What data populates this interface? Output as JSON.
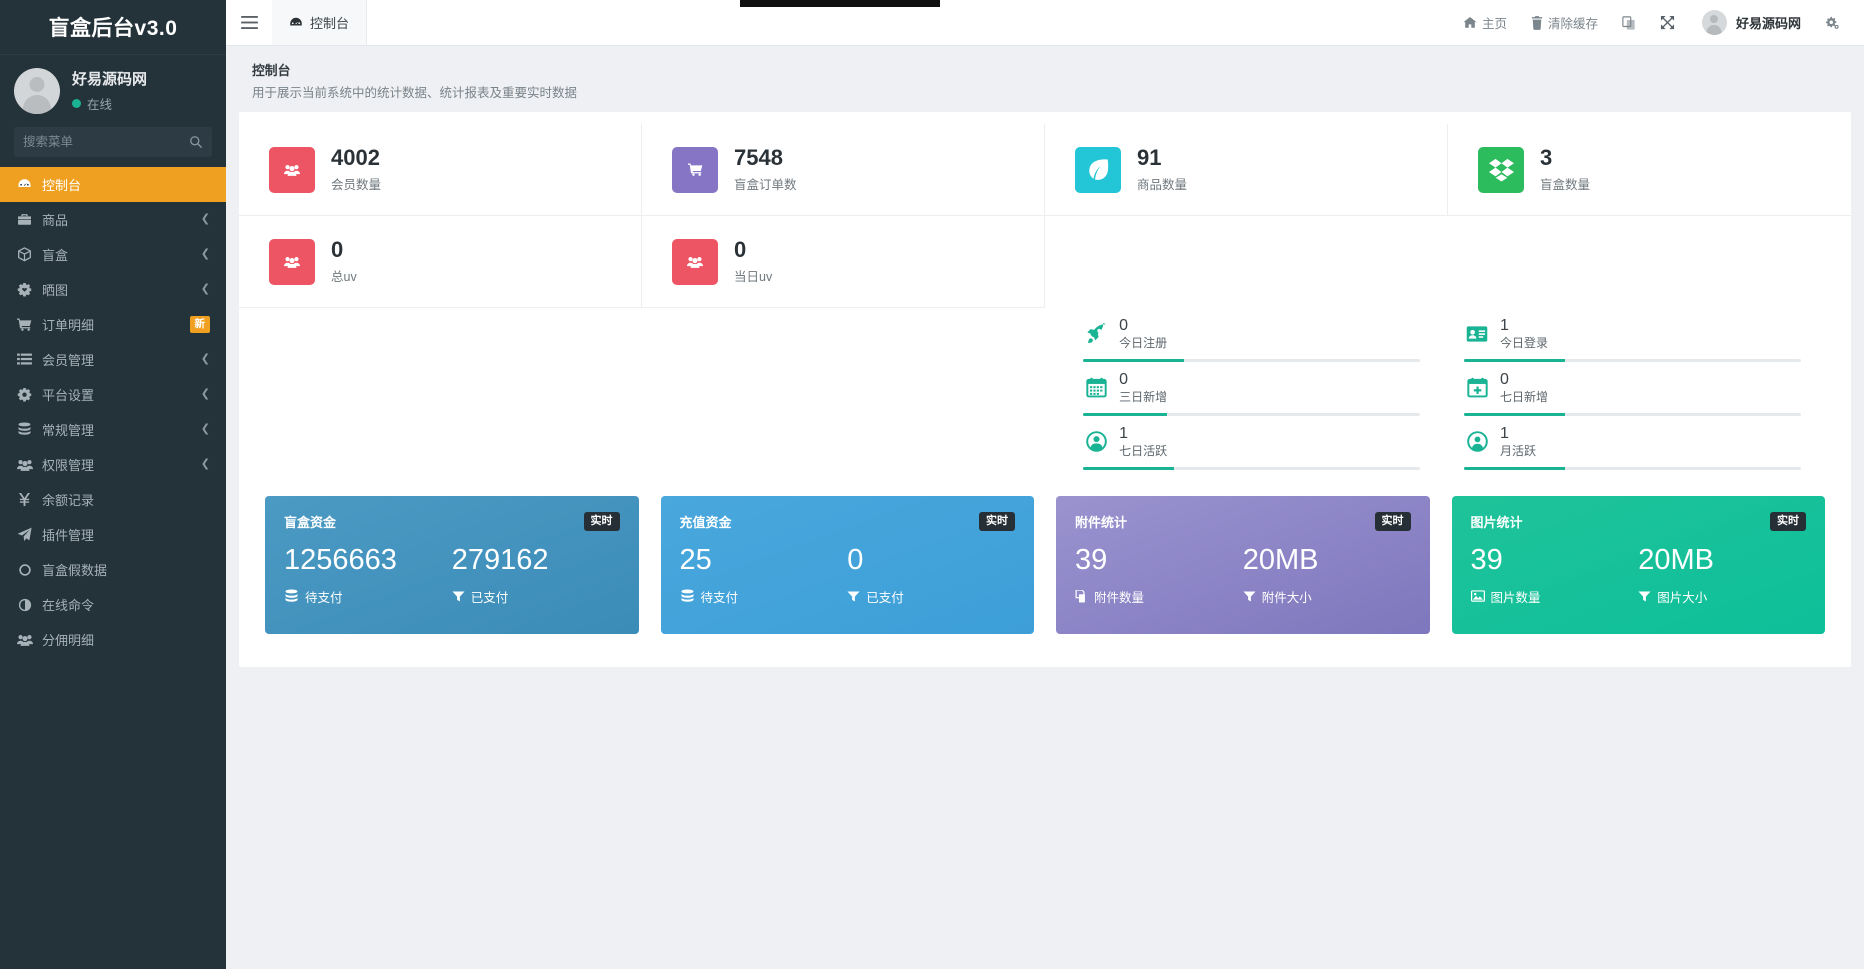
{
  "brand": {
    "title": "盲盒后台v3.0"
  },
  "profile": {
    "name": "好易源码网",
    "status": "在线"
  },
  "search": {
    "placeholder": "搜索菜单",
    "value": "",
    "icon": "search-icon"
  },
  "sidebar": {
    "items": [
      {
        "label": "控制台",
        "icon": "dashboard-icon",
        "active": true,
        "arrow": false,
        "badge": null
      },
      {
        "label": "商品",
        "icon": "briefcase-icon",
        "active": false,
        "arrow": true,
        "badge": null
      },
      {
        "label": "盲盒",
        "icon": "cube-icon",
        "active": false,
        "arrow": true,
        "badge": null
      },
      {
        "label": "晒图",
        "icon": "gear-heart-icon",
        "active": false,
        "arrow": true,
        "badge": null
      },
      {
        "label": "订单明细",
        "icon": "cart-icon",
        "active": false,
        "arrow": false,
        "badge": "新"
      },
      {
        "label": "会员管理",
        "icon": "list-icon",
        "active": false,
        "arrow": true,
        "badge": null
      },
      {
        "label": "平台设置",
        "icon": "gear-icon",
        "active": false,
        "arrow": true,
        "badge": null
      },
      {
        "label": "常规管理",
        "icon": "database-icon",
        "active": false,
        "arrow": true,
        "badge": null
      },
      {
        "label": "权限管理",
        "icon": "users-icon",
        "active": false,
        "arrow": true,
        "badge": null
      },
      {
        "label": "余额记录",
        "icon": "yen-icon",
        "active": false,
        "arrow": false,
        "badge": null
      },
      {
        "label": "插件管理",
        "icon": "paper-plane-icon",
        "active": false,
        "arrow": false,
        "badge": null
      },
      {
        "label": "盲盒假数据",
        "icon": "circle-icon",
        "active": false,
        "arrow": false,
        "badge": null
      },
      {
        "label": "在线命令",
        "icon": "contrast-icon",
        "active": false,
        "arrow": false,
        "badge": null
      },
      {
        "label": "分佣明细",
        "icon": "users-icon",
        "active": false,
        "arrow": false,
        "badge": null
      }
    ]
  },
  "topbar": {
    "menu_icon": "hamburger-icon",
    "tab": {
      "label": "控制台",
      "icon": "dashboard-icon"
    },
    "actions": [
      {
        "label": "主页",
        "icon": "home-icon"
      },
      {
        "label": "清除缓存",
        "icon": "trash-icon"
      },
      {
        "label": "",
        "icon": "theme-icon"
      },
      {
        "label": "",
        "icon": "expand-icon"
      }
    ],
    "user": {
      "name": "好易源码网",
      "avatar": "avatar"
    },
    "settings_icon": "settings-gear-icon"
  },
  "page": {
    "title": "控制台",
    "subtitle": "用于展示当前系统中的统计数据、统计报表及重要实时数据"
  },
  "stats": [
    {
      "value": "4002",
      "label": "会员数量",
      "icon": "users-icon",
      "color": "#ed5565"
    },
    {
      "value": "7548",
      "label": "盲盒订单数",
      "icon": "cart-icon",
      "color": "#8675c4"
    },
    {
      "value": "91",
      "label": "商品数量",
      "icon": "leaf-icon",
      "color": "#23c6d6"
    },
    {
      "value": "3",
      "label": "盲盒数量",
      "icon": "dropbox-icon",
      "color": "#2cbb5d"
    },
    {
      "value": "0",
      "label": "总uv",
      "icon": "users-icon",
      "color": "#ed5565"
    },
    {
      "value": "0",
      "label": "当日uv",
      "icon": "users-icon",
      "color": "#ed5565"
    }
  ],
  "mini_stats": [
    {
      "value": "0",
      "label": "今日注册",
      "icon": "rocket-icon",
      "progress": 30
    },
    {
      "value": "1",
      "label": "今日登录",
      "icon": "id-card-icon",
      "progress": 30
    },
    {
      "value": "0",
      "label": "三日新增",
      "icon": "calendar-icon",
      "progress": 25
    },
    {
      "value": "0",
      "label": "七日新增",
      "icon": "calendar-plus-icon",
      "progress": 30
    },
    {
      "value": "1",
      "label": "七日活跃",
      "icon": "user-circle-icon",
      "progress": 27
    },
    {
      "value": "1",
      "label": "月活跃",
      "icon": "user-circle-solid-icon",
      "progress": 30
    }
  ],
  "color_panels": [
    {
      "title": "盲盒资金",
      "badge": "实时",
      "color_from": "#4a9ac4",
      "color_to": "#3c8cb8",
      "left": {
        "value": "1256663",
        "label": "待支付",
        "icon": "database-icon"
      },
      "right": {
        "value": "279162",
        "label": "已支付",
        "icon": "filter-icon"
      }
    },
    {
      "title": "充值资金",
      "badge": "实时",
      "color_from": "#49a7dc",
      "color_to": "#3d9fd8",
      "left": {
        "value": "25",
        "label": "待支付",
        "icon": "database-icon"
      },
      "right": {
        "value": "0",
        "label": "已支付",
        "icon": "filter-icon"
      }
    },
    {
      "title": "附件统计",
      "badge": "实时",
      "color_from": "#9a93cf",
      "color_to": "#7f77bd",
      "left": {
        "value": "39",
        "label": "附件数量",
        "icon": "files-icon"
      },
      "right": {
        "value": "20MB",
        "label": "附件大小",
        "icon": "filter-icon"
      }
    },
    {
      "title": "图片统计",
      "badge": "实时",
      "color_from": "#1fc39a",
      "color_to": "#0dbf99",
      "left": {
        "value": "39",
        "label": "图片数量",
        "icon": "image-icon"
      },
      "right": {
        "value": "20MB",
        "label": "图片大小",
        "icon": "filter-icon"
      }
    }
  ],
  "colors": {
    "sidebar_bg": "#24323a",
    "accent": "#f0a020",
    "teal": "#1ab394",
    "page_bg": "#eef0f3"
  }
}
